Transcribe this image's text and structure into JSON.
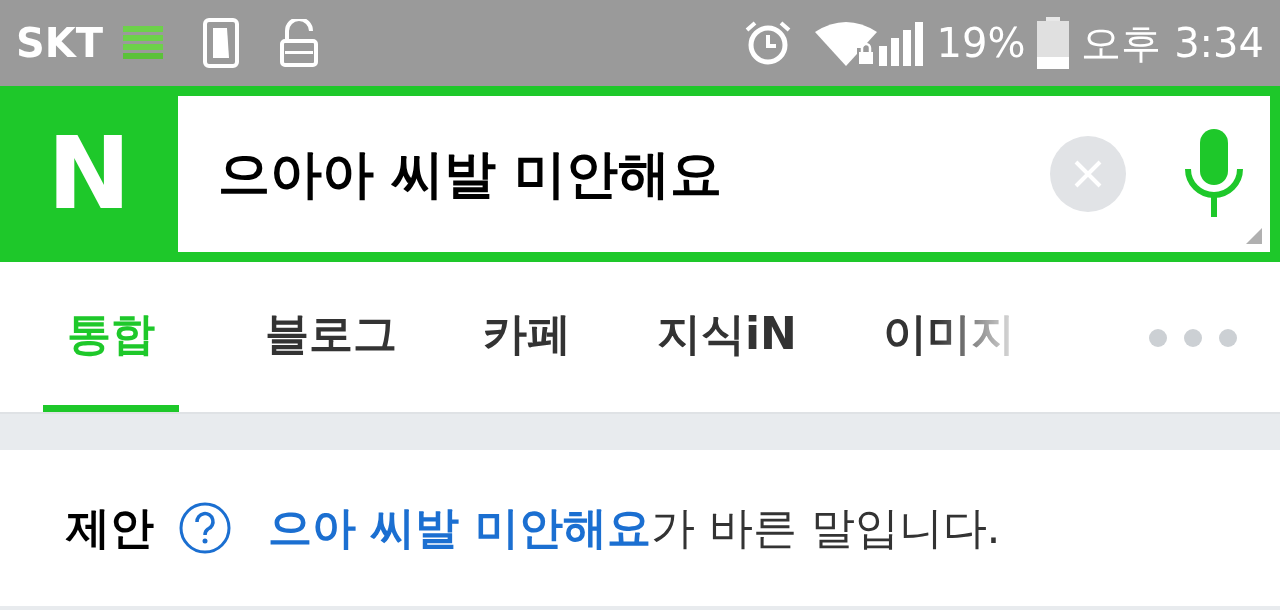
{
  "status_bar": {
    "carrier": "SKT",
    "battery": "19%",
    "time": "오후 3:34"
  },
  "search": {
    "logo": "N",
    "value": "으아아 씨발 미안해요"
  },
  "tabs": [
    {
      "label": "통합",
      "selected": true
    },
    {
      "label": "블로그",
      "selected": false
    },
    {
      "label": "카페",
      "selected": false
    },
    {
      "label": "지식iN",
      "selected": false
    },
    {
      "label": "이미지",
      "selected": false
    }
  ],
  "suggestion": {
    "label": "제안",
    "link": "으아 씨발 미안해요",
    "rest": "가 바른 말입니다."
  }
}
